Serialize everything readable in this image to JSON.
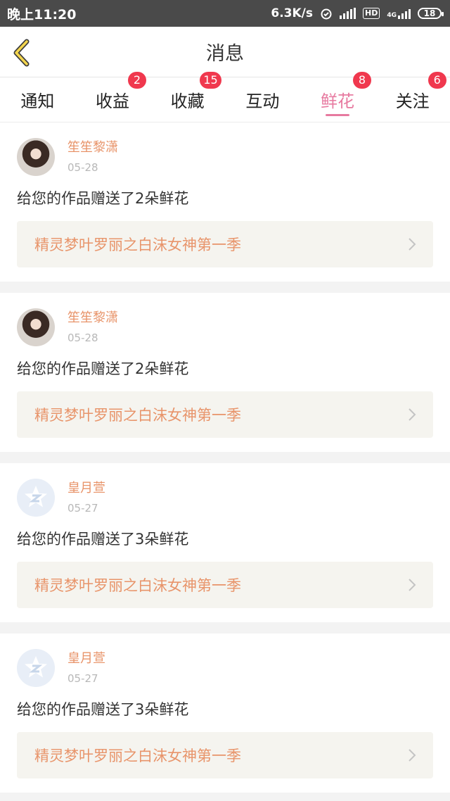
{
  "status_bar": {
    "time": "晚上11:20",
    "speed": "6.3K/s",
    "hd": "HD",
    "network": "4G",
    "battery": "18"
  },
  "header": {
    "title": "消息"
  },
  "tabs": [
    {
      "label": "通知",
      "badge": "",
      "active": false
    },
    {
      "label": "收益",
      "badge": "2",
      "active": false
    },
    {
      "label": "收藏",
      "badge": "15",
      "active": false
    },
    {
      "label": "互动",
      "badge": "",
      "active": false
    },
    {
      "label": "鲜花",
      "badge": "8",
      "active": true
    },
    {
      "label": "关注",
      "badge": "6",
      "active": false
    }
  ],
  "messages": [
    {
      "username": "笙笙黎潇",
      "date": "05-28",
      "text": "给您的作品赠送了2朵鲜花",
      "work": "精灵梦叶罗丽之白沫女神第一季",
      "avatar": "photo"
    },
    {
      "username": "笙笙黎潇",
      "date": "05-28",
      "text": "给您的作品赠送了2朵鲜花",
      "work": "精灵梦叶罗丽之白沫女神第一季",
      "avatar": "photo"
    },
    {
      "username": "皇月萱",
      "date": "05-27",
      "text": "给您的作品赠送了3朵鲜花",
      "work": "精灵梦叶罗丽之白沫女神第一季",
      "avatar": "default"
    },
    {
      "username": "皇月萱",
      "date": "05-27",
      "text": "给您的作品赠送了3朵鲜花",
      "work": "精灵梦叶罗丽之白沫女神第一季",
      "avatar": "default"
    }
  ],
  "colors": {
    "accent": "#e77aa0",
    "username": "#e8946a",
    "badge": "#f0384e"
  }
}
